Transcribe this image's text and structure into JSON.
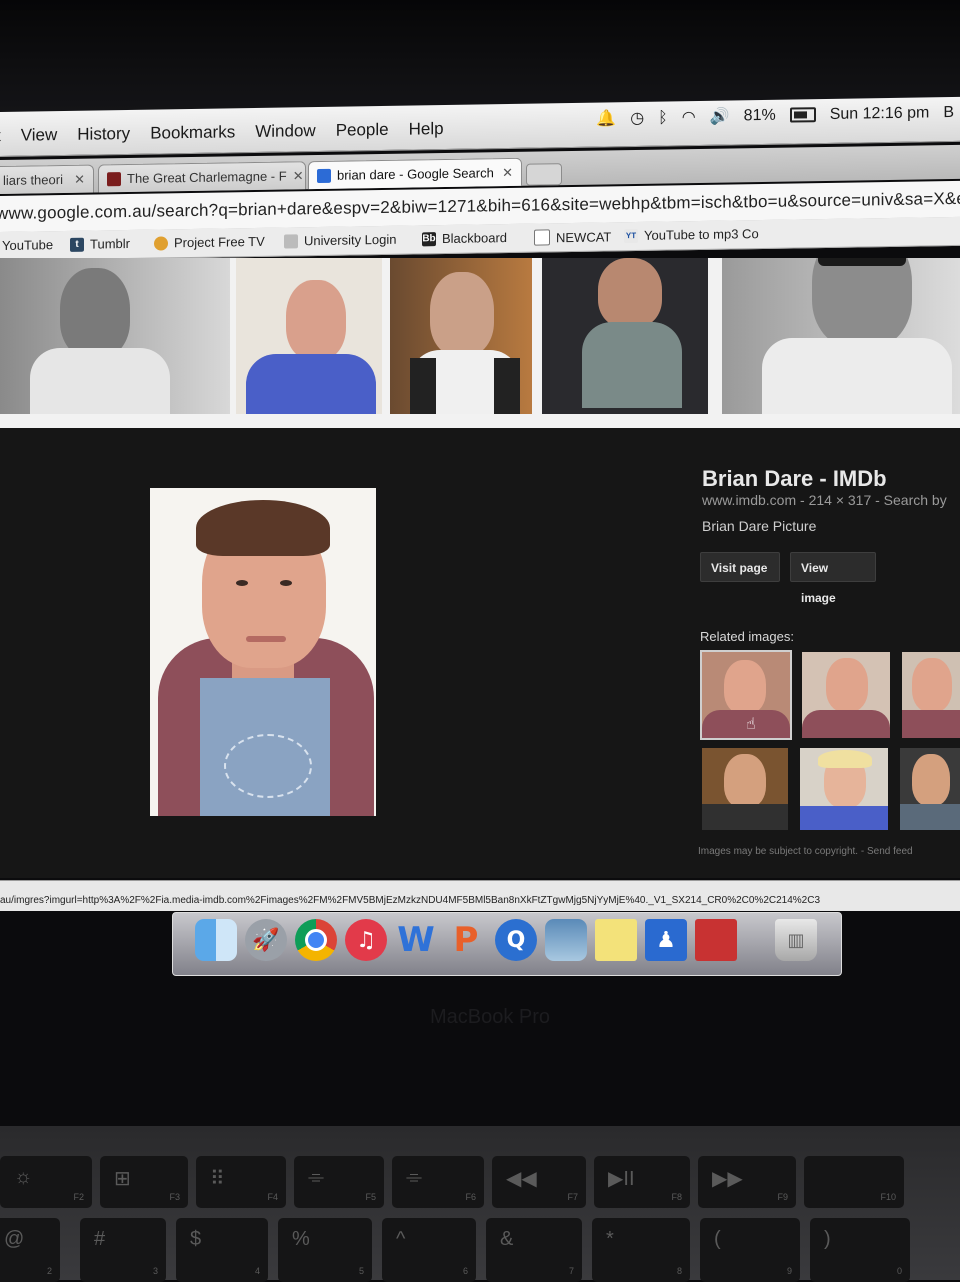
{
  "menubar": {
    "menus": [
      "t",
      "View",
      "History",
      "Bookmarks",
      "Window",
      "People",
      "Help"
    ],
    "status": {
      "battery": "81%",
      "clock": "Sun 12:16 pm",
      "user": "B"
    }
  },
  "tabs": [
    {
      "label": "liars theori"
    },
    {
      "label": "The Great Charlemagne - F"
    },
    {
      "label": "brian dare - Google Search"
    }
  ],
  "address": {
    "url": "www.google.com.au/search?q=brian+dare&espv=2&biw=1271&bih=616&site=webhp&tbm=isch&tbo=u&source=univ&sa=X&e"
  },
  "bookmarks": [
    {
      "label": "YouTube"
    },
    {
      "label": "Tumblr",
      "icon": "t"
    },
    {
      "label": "Project Free TV"
    },
    {
      "label": "University Login"
    },
    {
      "label": "Blackboard",
      "icon": "Bb"
    },
    {
      "label": "NEWCAT"
    },
    {
      "label": "YouTube to mp3 Co",
      "icon": "YT"
    }
  ],
  "preview": {
    "title": "Brian Dare - IMDb",
    "meta": "www.imdb.com - 214 × 317 - Search by",
    "description": "Brian Dare Picture",
    "visit_label": "Visit page",
    "view_label": "View image",
    "related_label": "Related images:",
    "copyright": "Images may be subject to copyright. - Send feed"
  },
  "statusbar": {
    "url": "au/imgres?imgurl=http%3A%2F%2Fia.media-imdb.com%2Fimages%2FM%2FMV5BMjEzMzkzNDU4MF5BMl5Ban8nXkFtZTgwMjg5NjYyMjE%40._V1_SX214_CR0%2C0%2C214%2C3"
  },
  "dock_icons": [
    "finder-icon",
    "launchpad-icon",
    "chrome-icon",
    "itunes-icon",
    "word-icon",
    "powerpoint-icon",
    "quicktime-icon",
    "preview-icon",
    "stickies-icon",
    "vlc-icon",
    "photo-booth-icon",
    "trash-icon"
  ],
  "laptop": {
    "brand": "MacBook Pro"
  },
  "keyboard": {
    "fn_row": [
      {
        "icon": "☼",
        "fn": "F2"
      },
      {
        "icon": "⊞",
        "fn": "F3"
      },
      {
        "icon": "⠿",
        "fn": "F4"
      },
      {
        "icon": "⌯",
        "fn": "F5"
      },
      {
        "icon": "⌯",
        "fn": "F6"
      },
      {
        "icon": "◀◀",
        "fn": "F7"
      },
      {
        "icon": "▶II",
        "fn": "F8"
      },
      {
        "icon": "▶▶",
        "fn": "F9"
      },
      {
        "icon": "",
        "fn": "F10"
      }
    ],
    "num_row": [
      "@",
      "#",
      "$",
      "%",
      "^",
      "&",
      "*",
      "(",
      ")"
    ],
    "num_row_sub": [
      "2",
      "3",
      "4",
      "5",
      "6",
      "7",
      "8",
      "9",
      "0"
    ]
  }
}
